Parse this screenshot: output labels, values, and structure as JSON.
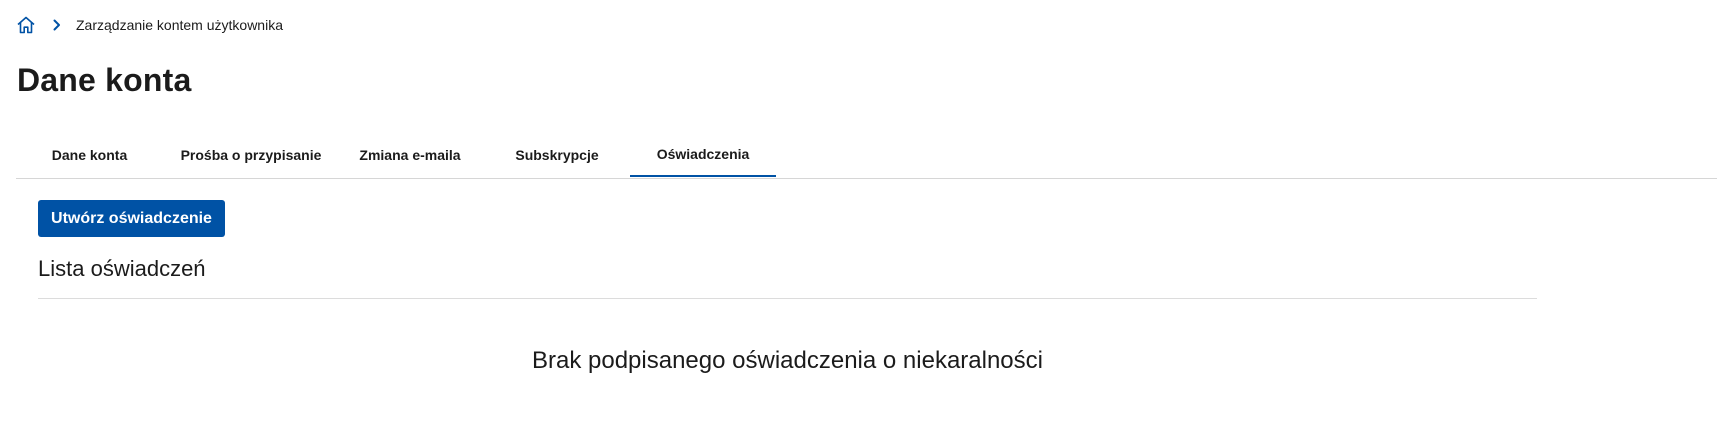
{
  "breadcrumb": {
    "home_icon": "home-icon",
    "separator_icon": "chevron-right-icon",
    "current": "Zarządzanie kontem użytkownika"
  },
  "page": {
    "title": "Dane konta"
  },
  "tabs": [
    {
      "label": "Dane konta",
      "active": false
    },
    {
      "label": "Prośba o przypisanie",
      "active": false
    },
    {
      "label": "Zmiana e-maila",
      "active": false
    },
    {
      "label": "Subskrypcje",
      "active": false
    },
    {
      "label": "Oświadczenia",
      "active": true
    }
  ],
  "main": {
    "create_button_label": "Utwórz oświadczenie",
    "list_title": "Lista oświadczeń",
    "empty_message": "Brak podpisanego oświadczenia o niekaralności"
  },
  "colors": {
    "primary": "#0052a5",
    "text": "#1b1b1b",
    "divider": "#d6d6d6"
  }
}
